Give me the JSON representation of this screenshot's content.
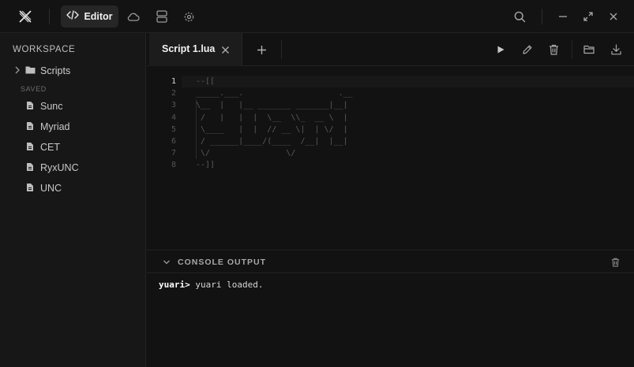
{
  "header": {
    "active_tab_label": "Editor",
    "nav_icons": [
      "app-logo-icon",
      "code-icon",
      "cloud-icon",
      "layout-icon",
      "gear-icon"
    ],
    "window_icons": [
      "search-icon",
      "minimize-icon",
      "maximize-icon",
      "close-icon"
    ]
  },
  "sidebar": {
    "title": "WORKSPACE",
    "folder": "Scripts",
    "saved_title": "SAVED",
    "items": [
      {
        "label": "Sunc"
      },
      {
        "label": "Myriad"
      },
      {
        "label": "CET"
      },
      {
        "label": "RyxUNC"
      },
      {
        "label": "UNC"
      }
    ]
  },
  "tabs": {
    "file": "Script 1.lua",
    "actions": [
      "play-icon",
      "pencil-icon",
      "trash-icon",
      "folder-open-icon",
      "download-icon"
    ]
  },
  "editor": {
    "active_line": 1,
    "line_numbers": [
      "1",
      "2",
      "3",
      "4",
      "5",
      "6",
      "7",
      "8"
    ],
    "lines": [
      "--[[",
      "_____.___.                    .__",
      "\\__  |   |__ _______ _______|__|",
      " /   |   |  |  \\__  \\\\_  __ \\  |",
      " \\____   |  |  // __ \\|  | \\/  |",
      " / ______|____/(____  /__|  |__|",
      " \\/                \\/",
      "--]]"
    ]
  },
  "console": {
    "title": "CONSOLE OUTPUT",
    "prompt": "yuari>",
    "message": " yuari loaded."
  },
  "colors": {
    "background": "#121212",
    "sidebar": "#171717",
    "active_tab": "#262626",
    "comment_text": "#5a5a5a"
  }
}
